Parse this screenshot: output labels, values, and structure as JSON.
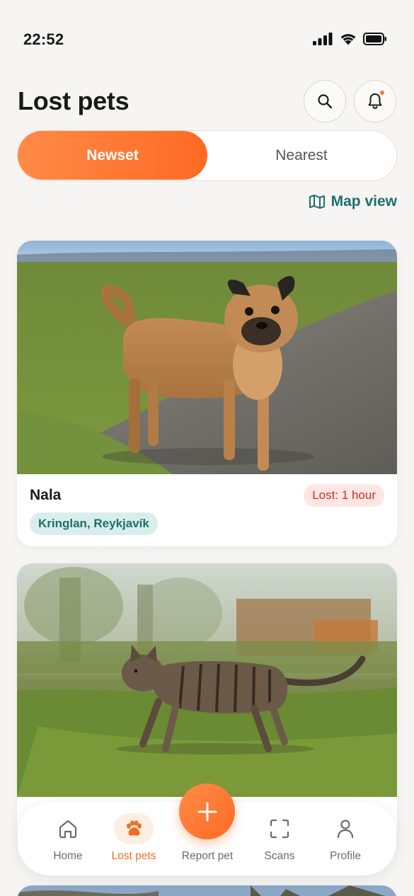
{
  "status_bar": {
    "time": "22:52"
  },
  "header": {
    "title": "Lost pets"
  },
  "tabs": [
    {
      "label": "Newset",
      "active": true
    },
    {
      "label": "Nearest",
      "active": false
    }
  ],
  "map_view_label": "Map view",
  "listings": [
    {
      "name": "Nala",
      "lost_label": "Lost: 1 hour",
      "location": "Kringlan, Reykjavík",
      "photo": "tan-pug-chihuahua-dog"
    },
    {
      "name": "",
      "lost_label": "",
      "location": "",
      "photo": "tabby-kitten"
    }
  ],
  "bottom_nav": {
    "items": [
      {
        "label": "Home",
        "icon": "home-icon"
      },
      {
        "label": "Lost pets",
        "icon": "paw-icon",
        "active": true
      },
      {
        "label": "Report pet",
        "icon": "plus-icon"
      },
      {
        "label": "Scans",
        "icon": "scan-icon"
      },
      {
        "label": "Profile",
        "icon": "user-icon"
      }
    ]
  },
  "colors": {
    "accent": "#ff6a25",
    "teal": "#1f6e6a",
    "lost_badge_bg": "#fde6e4",
    "location_badge_bg": "#d9eeec"
  }
}
